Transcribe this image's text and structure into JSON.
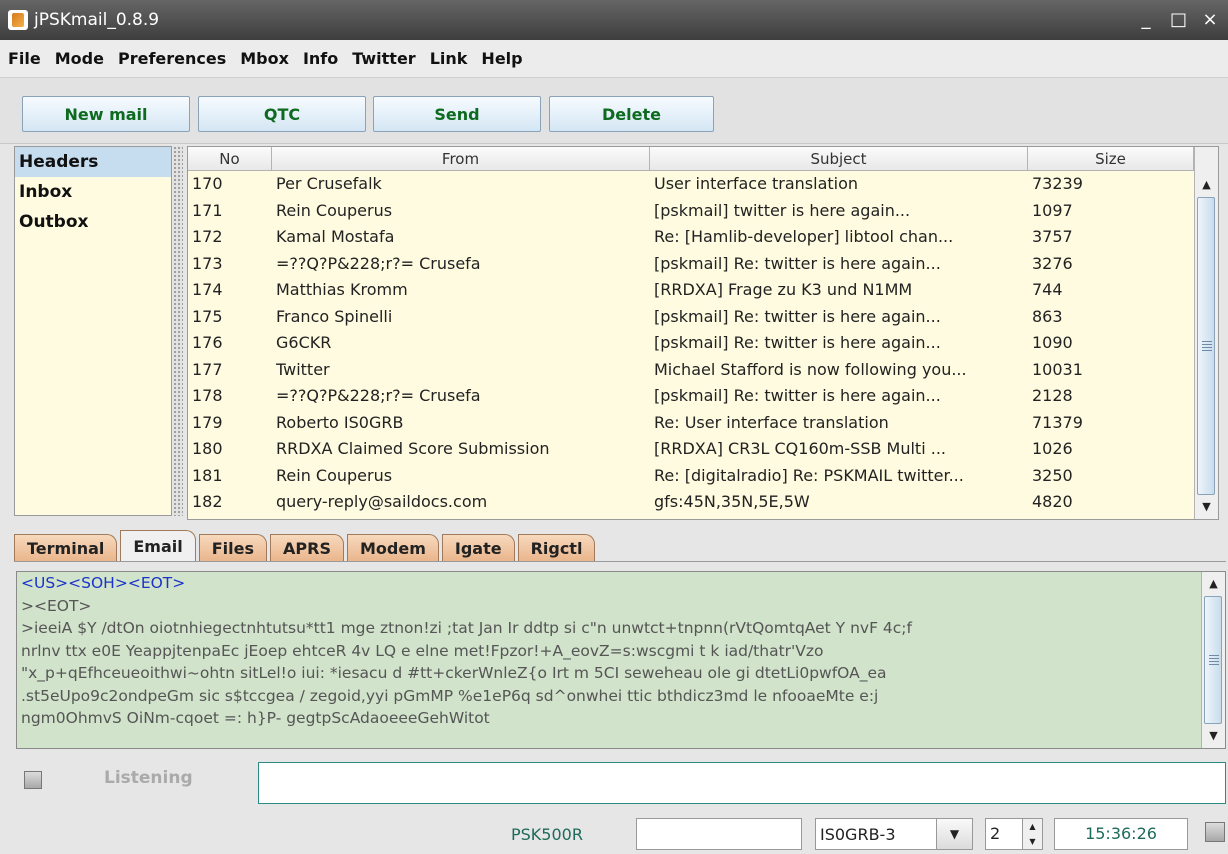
{
  "window": {
    "title": "jPSKmail_0.8.9",
    "controls": [
      "_",
      "□",
      "×"
    ]
  },
  "menu": [
    "File",
    "Mode",
    "Preferences",
    "Mbox",
    "Info",
    "Twitter",
    "Link",
    "Help"
  ],
  "toolbar": {
    "new_mail": "New mail",
    "qtc": "QTC",
    "send": "Send",
    "delete": "Delete"
  },
  "folders": [
    {
      "label": "Headers",
      "selected": true
    },
    {
      "label": "Inbox",
      "selected": false
    },
    {
      "label": "Outbox",
      "selected": false
    }
  ],
  "table": {
    "columns": [
      "No",
      "From",
      "Subject",
      "Size"
    ],
    "rows": [
      [
        "170",
        "Per Crusefalk",
        "User interface translation",
        "73239"
      ],
      [
        "171",
        "Rein Couperus",
        "[pskmail] twitter is here again...",
        "1097"
      ],
      [
        "172",
        "Kamal Mostafa",
        "Re: [Hamlib-developer] libtool chan...",
        "3757"
      ],
      [
        "173",
        "=??Q?P&228;r?= Crusefa",
        "[pskmail] Re: twitter is here again...",
        "3276"
      ],
      [
        "174",
        "Matthias Kromm",
        "[RRDXA] Frage zu K3 und N1MM",
        "744"
      ],
      [
        "175",
        "Franco Spinelli",
        "[pskmail] Re: twitter is here again...",
        "863"
      ],
      [
        "176",
        "G6CKR",
        "[pskmail] Re: twitter is here again...",
        "1090"
      ],
      [
        "177",
        "Twitter",
        "Michael Stafford is now following you...",
        "10031"
      ],
      [
        "178",
        "=??Q?P&228;r?= Crusefa",
        "[pskmail] Re: twitter is here again...",
        "2128"
      ],
      [
        "179",
        "Roberto IS0GRB",
        "Re: User interface translation",
        "71379"
      ],
      [
        "180",
        "RRDXA Claimed Score Submission",
        "[RRDXA] CR3L CQ160m-SSB  Multi ...",
        "1026"
      ],
      [
        "181",
        "Rein Couperus",
        "Re: [digitalradio] Re: PSKMAIL twitter...",
        "3250"
      ],
      [
        "182",
        "query-reply@saildocs.com",
        "gfs:45N,35N,5E,5W",
        "4820"
      ]
    ]
  },
  "tabs": [
    {
      "label": "Terminal",
      "active": false
    },
    {
      "label": "Email",
      "active": true
    },
    {
      "label": "Files",
      "active": false
    },
    {
      "label": "APRS",
      "active": false
    },
    {
      "label": "Modem",
      "active": false
    },
    {
      "label": "Igate",
      "active": false
    },
    {
      "label": "Rigctl",
      "active": false
    }
  ],
  "terminal": {
    "lines": [
      {
        "text": "<US><SOH><EOT>",
        "color": "blue"
      },
      {
        "text": "><EOT>",
        "color": "gray"
      },
      {
        "text": ">ieeiA $Y /dtOn oiotnhiegectnhtutsu*tt1 mge ztnon!zi  ;tat Jan Ir ddtp si c\"n unwtct+tnpnn(rVtQomtqAet Y nvF  4c;f",
        "color": "gray"
      },
      {
        "text": "nrlnv ttx e0E YeappjtenpaEc jEoep ehtceR 4v LQ e elne met!Fpzor!+A_eovZ=s:wscgmi t k iad/thatr'Vzo",
        "color": "gray"
      },
      {
        "text": "\"x_p+qEfhceueoithwi~ohtn sitLel!o iui: *iesacu  d  #tt+ckerWnleZ{o Irt m 5CI seweheau  ole gi dtetLi0pwfOA_ea",
        "color": "gray"
      },
      {
        "text": ".st5eUpo9c2ondpeGm sic  s$tccgea / zegoid,yyi pGmMP %e1eP6q sd^onwhei ttic bthdicz3md le nfooaeMte e:j",
        "color": "gray"
      },
      {
        "text": "ngm0OhmvS OiNm-cqoet  =: h}P- gegtpScAdaoeeeGehWitot",
        "color": "gray"
      }
    ]
  },
  "listen": {
    "label": "Listening",
    "input_value": ""
  },
  "status": {
    "mode": "PSK500R",
    "field_value": "",
    "callsign": "IS0GRB-3",
    "spinner_value": "2",
    "clock": "15:36:26"
  }
}
